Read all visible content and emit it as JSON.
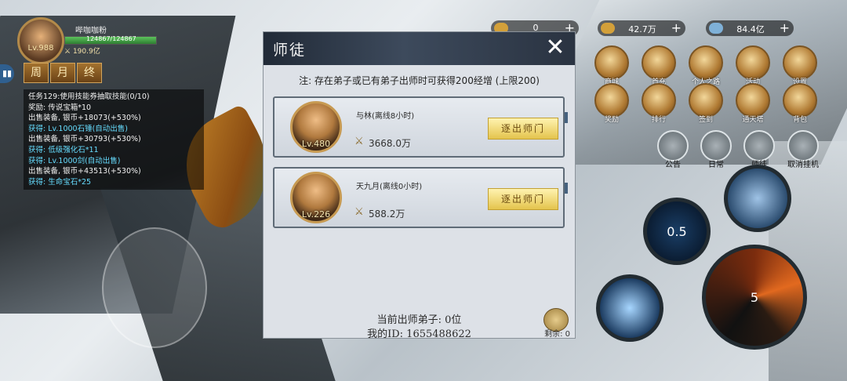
{
  "hud": {
    "player_name": "哔咖咖粉",
    "hp_text": "124867/124867",
    "hp_fraction": 1.0,
    "level_text": "Lv.988",
    "power_text": "190.9亿",
    "tabs": [
      "周",
      "月",
      "终"
    ],
    "side_button": "▮▮"
  },
  "task_log": [
    {
      "text": "任务129:使用技能券抽取技能(0/10)",
      "highlight": false
    },
    {
      "text": "奖励: 传说宝箱*10",
      "highlight": false
    },
    {
      "text": "出售装备, 银币+18073(+530%)",
      "highlight": false
    },
    {
      "text": "获得: Lv.1000石锤(自动出售)",
      "highlight": true
    },
    {
      "text": "出售装备, 银币+30793(+530%)",
      "highlight": false
    },
    {
      "text": "获得: 低级强化石*11",
      "highlight": true
    },
    {
      "text": "获得: Lv.1000剑(自动出售)",
      "highlight": true
    },
    {
      "text": "出售装备, 银币+43513(+530%)",
      "highlight": false
    },
    {
      "text": "获得: 生命宝石*25",
      "highlight": true
    }
  ],
  "currencies": [
    {
      "value": "0",
      "plus": "+"
    },
    {
      "value": "42.7万",
      "plus": "+"
    },
    {
      "value": "84.4亿",
      "plus": "+"
    }
  ],
  "right_icons": [
    {
      "label": "商城"
    },
    {
      "label": "首充"
    },
    {
      "label": "个人之路"
    },
    {
      "label": "活动"
    },
    {
      "label": "设置"
    },
    {
      "label": "奖励"
    },
    {
      "label": "排行"
    },
    {
      "label": "签到"
    },
    {
      "label": "通天塔"
    },
    {
      "label": "背包"
    }
  ],
  "small_icons": [
    {
      "label": "公告"
    },
    {
      "label": "日常"
    },
    {
      "label": "师徒"
    },
    {
      "label": "取消挂机"
    }
  ],
  "skills": [
    {
      "label": ""
    },
    {
      "label": "0.5"
    },
    {
      "label": ""
    },
    {
      "label": "5"
    }
  ],
  "dialog": {
    "title": "师徒",
    "close": "✕",
    "note": "注: 存在弟子或已有弟子出师时可获得200经增 (上限200)",
    "apprentices": [
      {
        "level": "Lv.480",
        "name": "与林(离线8小时)",
        "power": "3668.0万",
        "button": "逐出师门"
      },
      {
        "level": "Lv.226",
        "name": "天九月(离线0小时)",
        "power": "588.2万",
        "button": "逐出师门"
      }
    ],
    "graduated": "当前出师弟子: 0位",
    "my_id": "我的ID: 1655488622",
    "remaining": "剩余: 0"
  }
}
